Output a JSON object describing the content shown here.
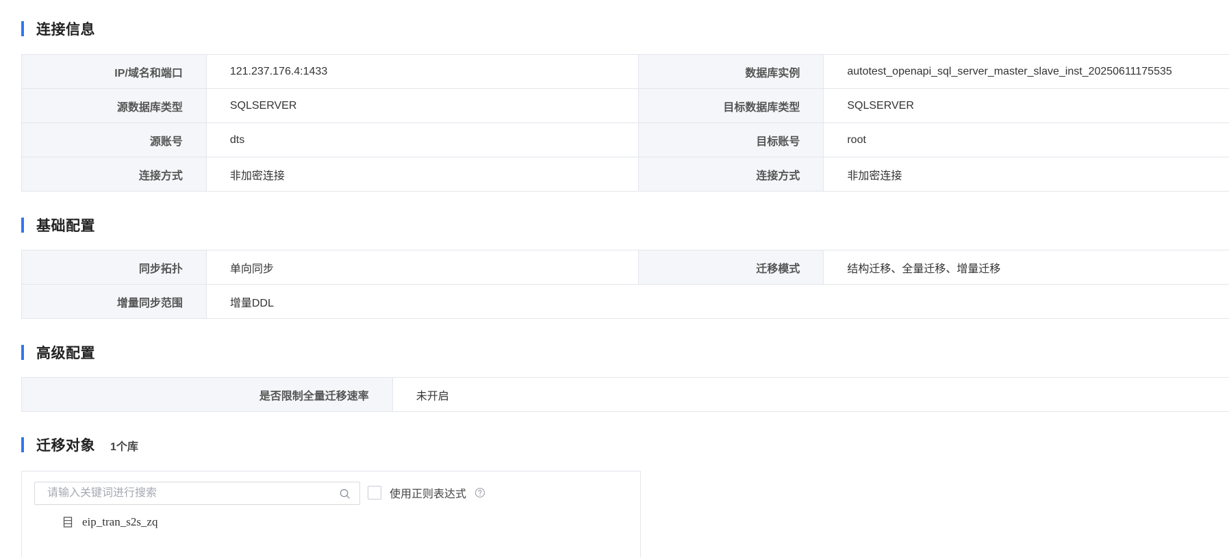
{
  "sections": {
    "connection": {
      "title": "连接信息"
    },
    "basic": {
      "title": "基础配置"
    },
    "advanced": {
      "title": "高级配置"
    },
    "objects": {
      "title": "迁移对象",
      "count": "1个库"
    }
  },
  "connection": {
    "rows": [
      {
        "left_label": "IP/域名和端口",
        "left_value": "121.237.176.4:1433",
        "right_label": "数据库实例",
        "right_value": "autotest_openapi_sql_server_master_slave_inst_20250611175535"
      },
      {
        "left_label": "源数据库类型",
        "left_value": "SQLSERVER",
        "right_label": "目标数据库类型",
        "right_value": "SQLSERVER"
      },
      {
        "left_label": "源账号",
        "left_value": "dts",
        "right_label": "目标账号",
        "right_value": "root"
      },
      {
        "left_label": "连接方式",
        "left_value": "非加密连接",
        "right_label": "连接方式",
        "right_value": "非加密连接"
      }
    ]
  },
  "basic": {
    "row1": {
      "left_label": "同步拓扑",
      "left_value": "单向同步",
      "right_label": "迁移模式",
      "right_value": "结构迁移、全量迁移、增量迁移"
    },
    "row2": {
      "label": "增量同步范围",
      "value": "增量DDL"
    }
  },
  "advanced": {
    "label": "是否限制全量迁移速率",
    "value": "未开启"
  },
  "objects": {
    "search_placeholder": "请输入关键词进行搜索",
    "search_value": "",
    "regex_label": "使用正则表达式",
    "regex_checked": false,
    "items": [
      {
        "name": "eip_tran_s2s_zq",
        "icon": "database-icon"
      }
    ]
  },
  "colors": {
    "accent": "#3277f0",
    "label_bg": "#f5f6f9",
    "border": "#e3e6ec"
  }
}
